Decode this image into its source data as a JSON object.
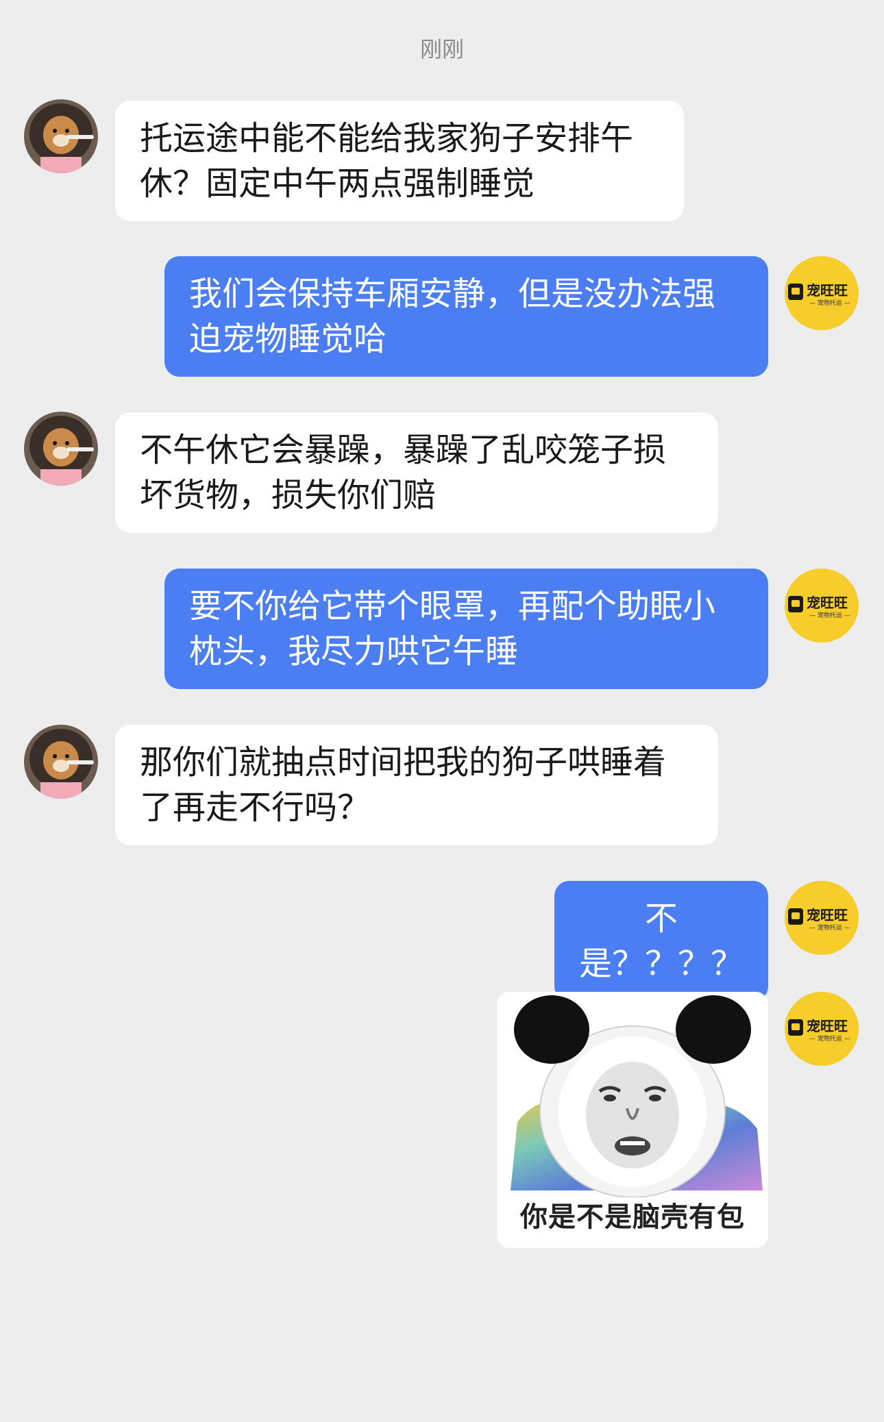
{
  "timestamp": "刚刚",
  "messages": [
    {
      "side": "in",
      "text": "托运途中能不能给我家狗子安排午休？固定中午两点强制睡觉"
    },
    {
      "side": "out",
      "text": "我们会保持车厢安静，但是没办法强迫宠物睡觉哈"
    },
    {
      "side": "in",
      "text": "不午休它会暴躁，暴躁了乱咬笼子损坏货物，损失你们赔"
    },
    {
      "side": "out",
      "text": "要不你给它带个眼罩，再配个助眠小枕头，我尽力哄它午睡"
    },
    {
      "side": "in",
      "text": "那你们就抽点时间把我的狗子哄睡着了再走不行吗？"
    },
    {
      "side": "out",
      "text": "不是？？？？"
    }
  ],
  "sticker": {
    "caption": "你是不是脑壳有包",
    "icon": "panda-meme-face"
  },
  "shop_avatar": {
    "name": "宠旺旺",
    "tagline": "— 宠物托运 —",
    "bg_color": "#f7cd2c"
  },
  "colors": {
    "background": "#ededed",
    "incoming_bubble": "#ffffff",
    "outgoing_bubble": "#4a7ef2"
  }
}
